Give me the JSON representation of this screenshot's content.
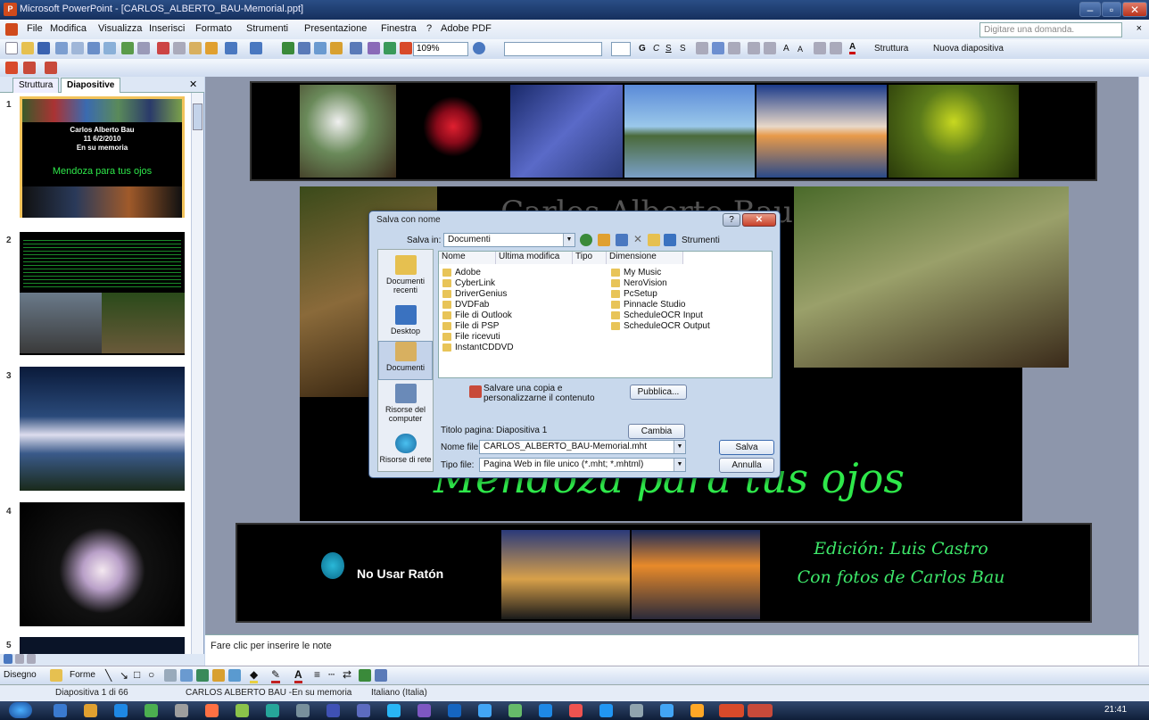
{
  "window": {
    "title": "Microsoft PowerPoint - [CARLOS_ALBERTO_BAU-Memorial.ppt]"
  },
  "menu": [
    "File",
    "Modifica",
    "Visualizza",
    "Inserisci",
    "Formato",
    "Strumenti",
    "Presentazione",
    "Finestra",
    "?",
    "Adobe PDF"
  ],
  "ask_placeholder": "Digitare una domanda.",
  "toolbar": {
    "zoom": "109%",
    "struttura": "Struttura",
    "nuova_diapositiva": "Nuova diapositiva"
  },
  "left_pane": {
    "tabs": [
      "Struttura",
      "Diapositive"
    ],
    "slide_numbers": [
      "1",
      "2",
      "3",
      "4",
      "5"
    ],
    "slide1_text": [
      "Carlos Alberto Bau",
      "11 6/2/2010",
      "En su memoria",
      "Mendoza para tus ojos"
    ]
  },
  "slide": {
    "title_overlay": "Carlos Alberto Bau",
    "main_title": "Mendoza para tus ojos",
    "no_mouse": "No Usar Ratón",
    "credit_line1": "Edición: Luis Castro",
    "credit_line2": "Con fotos de Carlos Bau"
  },
  "dialog": {
    "title": "Salva con nome",
    "save_in_label": "Salva in:",
    "save_in_value": "Documenti",
    "tools_label": "Strumenti",
    "places": [
      "Documenti recenti",
      "Desktop",
      "Documenti",
      "Risorse del computer",
      "Risorse di rete"
    ],
    "columns": [
      "Nome",
      "Ultima modifica",
      "Tipo",
      "Dimensione"
    ],
    "files_left": [
      "Adobe",
      "CyberLink",
      "DriverGenius",
      "DVDFab",
      "File di Outlook",
      "File di PSP",
      "File ricevuti",
      "InstantCDDVD"
    ],
    "files_right": [
      "My Music",
      "NeroVision",
      "PcSetup",
      "Pinnacle Studio",
      "ScheduleOCR Input",
      "ScheduleOCR Output"
    ],
    "publish_text": "Salvare una copia e personalizzarne il contenuto",
    "publish_button": "Pubblica...",
    "page_title_label": "Titolo pagina:",
    "page_title_value": "Diapositiva 1",
    "change_title_button": "Cambia titolo...",
    "filename_label": "Nome file:",
    "filename_value": "CARLOS_ALBERTO_BAU-Memorial.mht",
    "filetype_label": "Tipo file:",
    "filetype_value": "Pagina Web in file unico (*.mht; *.mhtml)",
    "save_button": "Salva",
    "cancel_button": "Annulla"
  },
  "notes_placeholder": "Fare clic per inserire le note",
  "drawbar": {
    "disegno": "Disegno",
    "forme": "Forme"
  },
  "status": {
    "slide": "Diapositiva 1 di 66",
    "design": "CARLOS ALBERTO BAU -En su memoria",
    "language": "Italiano (Italia)"
  },
  "taskbar": {
    "clock": "21:41"
  }
}
